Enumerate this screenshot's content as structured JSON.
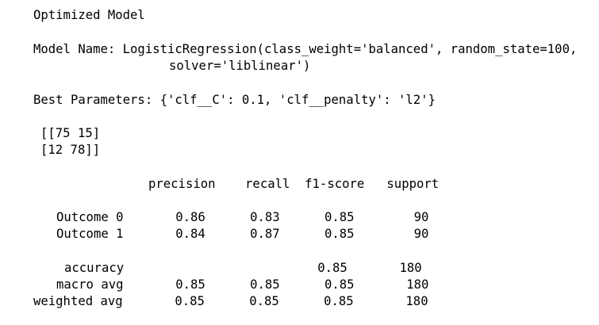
{
  "output": {
    "heading": "Optimized Model",
    "model_name_line1": "Model Name: LogisticRegression(class_weight='balanced', random_state=100,",
    "model_name_line2": "solver='liblinear')",
    "best_params": "Best Parameters: {'clf__C': 0.1, 'clf__penalty': 'l2'}",
    "confusion_matrix": [
      "[[75 15]",
      "[12 78]]"
    ],
    "report": {
      "header": "precision    recall  f1-score   support",
      "rows": [
        "Outcome 0       0.86      0.83      0.85        90",
        "Outcome 1       0.84      0.87      0.85        90"
      ],
      "summary": [
        "accuracy                          0.85       180",
        "macro avg       0.85      0.85      0.85       180",
        "weighted avg       0.85      0.85      0.85       180"
      ]
    }
  }
}
